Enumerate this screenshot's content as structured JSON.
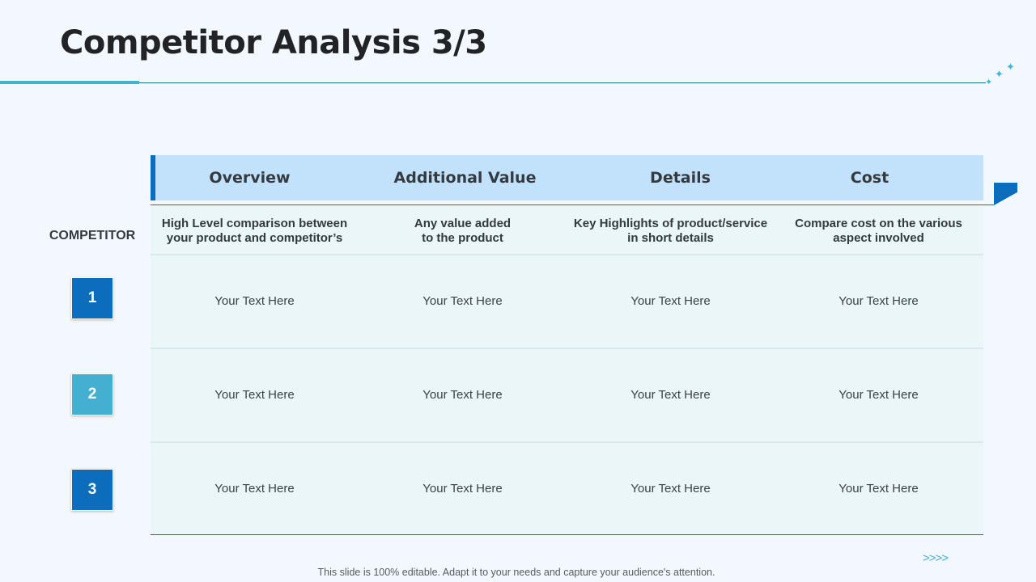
{
  "slide": {
    "title": "Competitor Analysis 3/3",
    "footer_note": "This slide is 100% editable. Adapt it to your needs and capture your audience's attention.",
    "next_indicator": ">>>>"
  },
  "decorations": {
    "sparkle_icon": "four-point-star-icon",
    "next_icon": "chevron-arrows-icon"
  },
  "table": {
    "row_label": "COMPETITOR",
    "columns": [
      {
        "header": "Overview",
        "description": "High Level comparison between\nyour product and competitor’s"
      },
      {
        "header": "Additional Value",
        "description": "Any  value added\nto the product"
      },
      {
        "header": "Details",
        "description": "Key Highlights of product/service\nin short details"
      },
      {
        "header": "Cost",
        "description": "Compare cost on the various\naspect involved"
      }
    ],
    "rows": [
      {
        "number": "1",
        "color": "#0c6dbd",
        "cells": [
          "Your Text Here",
          "Your Text Here",
          "Your Text Here",
          "Your Text Here"
        ]
      },
      {
        "number": "2",
        "color": "#44afd0",
        "cells": [
          "Your Text Here",
          "Your Text Here",
          "Your Text Here",
          "Your Text Here"
        ]
      },
      {
        "number": "3",
        "color": "#0c6dbd",
        "cells": [
          "Your Text Here",
          "Your Text Here",
          "Your Text Here",
          "Your Text Here"
        ]
      }
    ]
  },
  "colors": {
    "background": "#f2f8fd",
    "header_fill": "#c2e2fb",
    "accent_dark_blue": "#0c6dbd",
    "accent_light_blue": "#44afd0",
    "table_fill": "#eaf6f8",
    "rule": "#1f6f8b"
  }
}
